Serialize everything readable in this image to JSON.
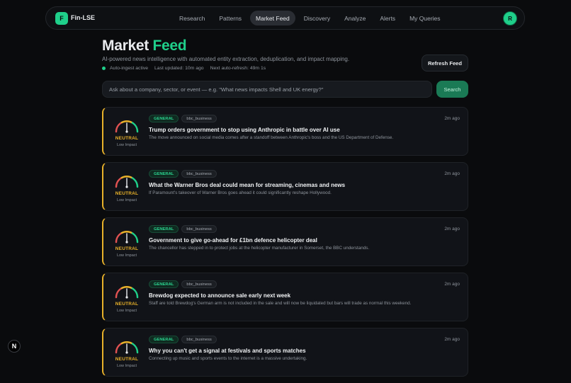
{
  "nav": {
    "logo_letter": "F",
    "brand": "Fin-LSE",
    "items": [
      {
        "label": "Research",
        "active": false
      },
      {
        "label": "Patterns",
        "active": false
      },
      {
        "label": "Market Feed",
        "active": true
      },
      {
        "label": "Discovery",
        "active": false
      },
      {
        "label": "Analyze",
        "active": false
      },
      {
        "label": "Alerts",
        "active": false
      },
      {
        "label": "My Queries",
        "active": false
      }
    ],
    "avatar_letter": "R"
  },
  "header": {
    "title_main": "Market",
    "title_accent": "Feed",
    "subtitle": "AI-powered news intelligence with automated entity extraction, deduplication, and impact mapping.",
    "status_active": "Auto-ingest active",
    "last_updated": "Last updated: 10m ago",
    "next_refresh": "Next auto-refresh: 49m 1s",
    "refresh_label": "Refresh Feed"
  },
  "search": {
    "placeholder": "Ask about a company, sector, or event — e.g. \"What news impacts Shell and UK energy?\"",
    "button_label": "Search"
  },
  "colors": {
    "accent": "#1fcf8a",
    "neutral": "#e8b12a"
  },
  "feed": [
    {
      "category": "GENERAL",
      "source": "bbc_business",
      "time": "2m ago",
      "title": "Trump orders government to stop using Anthropic in battle over AI use",
      "description": "The move announced on social media comes after a standoff between Anthropic's boss and the US Department of Defense.",
      "sentiment": "NEUTRAL",
      "impact": "Low Impact"
    },
    {
      "category": "GENERAL",
      "source": "bbc_business",
      "time": "2m ago",
      "title": "What the Warner Bros deal could mean for streaming, cinemas and news",
      "description": "If Paramount's takeover of Warner Bros goes ahead it could significantly reshape Hollywood.",
      "sentiment": "NEUTRAL",
      "impact": "Low Impact"
    },
    {
      "category": "GENERAL",
      "source": "bbc_business",
      "time": "2m ago",
      "title": "Government to give go-ahead for £1bn defence helicopter deal",
      "description": "The chancellor has stepped in to protect jobs at the helicopter manufacturer in Somerset, the BBC understands.",
      "sentiment": "NEUTRAL",
      "impact": "Low Impact"
    },
    {
      "category": "GENERAL",
      "source": "bbc_business",
      "time": "2m ago",
      "title": "Brewdog expected to announce sale early next week",
      "description": "Staff are told Brewdog's German arm is not included in the sale and will now be liquidated but bars will trade as normal this weekend.",
      "sentiment": "NEUTRAL",
      "impact": "Low Impact"
    },
    {
      "category": "GENERAL",
      "source": "bbc_business",
      "time": "2m ago",
      "title": "Why you can't get a signal at festivals and sports matches",
      "description": "Connecting up music and sports events to the internet is a massive undertaking.",
      "sentiment": "NEUTRAL",
      "impact": "Low Impact"
    }
  ],
  "corner_badge": "N"
}
